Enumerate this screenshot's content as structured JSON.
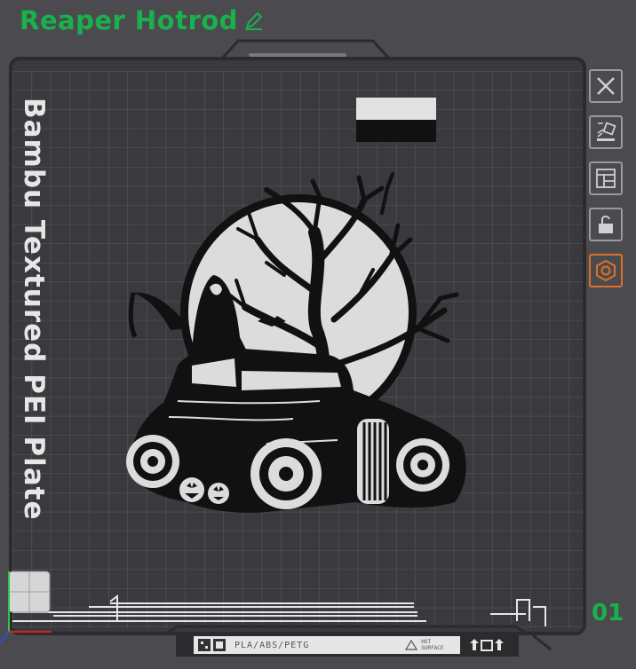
{
  "header": {
    "title": "Reaper Hotrod"
  },
  "plate": {
    "name": "Bambu Textured PEI Plate",
    "number": "01",
    "footer": {
      "filament": "PLA/ABS/PETG",
      "surface_line1": "HOT",
      "surface_line2": "SURFACE"
    }
  },
  "toolbar": {
    "items": [
      {
        "icon": "close-icon"
      },
      {
        "icon": "auto-arrange-icon"
      },
      {
        "icon": "layout-icon"
      },
      {
        "icon": "lock-icon"
      },
      {
        "icon": "settings-icon"
      }
    ]
  },
  "colors": {
    "title": "#19b14c",
    "plate_bg": "#3a3a3e",
    "grid": "#5a5a5f",
    "active_tool": "#e07028",
    "model": "#111111",
    "model_light": "#dcdcdc"
  }
}
